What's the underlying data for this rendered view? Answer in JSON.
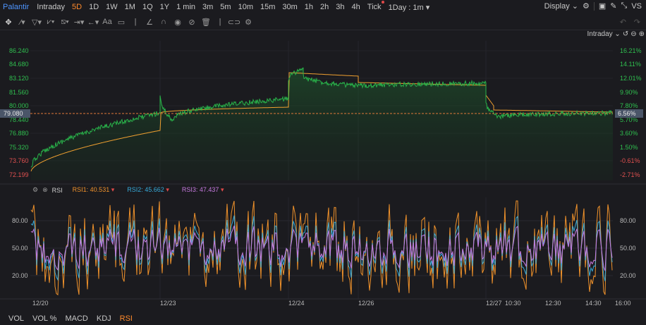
{
  "header": {
    "symbol": "Palantir",
    "timeframes": [
      "Intraday",
      "5D",
      "1D",
      "1W",
      "1M",
      "1Q",
      "1Y",
      "1 min",
      "3m",
      "5m",
      "10m",
      "15m",
      "30m",
      "1h",
      "2h",
      "3h",
      "4h",
      "Tick",
      "1Day : 1m"
    ],
    "active_timeframe": "5D",
    "display_label": "Display",
    "vs_label": "VS"
  },
  "session_label": "Intraday",
  "price_axis": [
    "86.240",
    "84.680",
    "83.120",
    "81.560",
    "80.000",
    "78.440",
    "76.880",
    "75.320",
    "73.760",
    "72.199"
  ],
  "current_price": "79.080",
  "pct_axis": [
    "16.21%",
    "14.11%",
    "12.01%",
    "9.90%",
    "7.80%",
    "5.70%",
    "3.60%",
    "1.50%",
    "-0.61%",
    "-2.71%"
  ],
  "current_pct": "6.56%",
  "x_axis": [
    "12/20",
    "12/23",
    "12/24",
    "12/26",
    "12/27",
    "10:30",
    "12:30",
    "14:30",
    "16:00"
  ],
  "rsi": {
    "title": "RSI",
    "rsi1_label": "RSI1:",
    "rsi1_value": "40.531",
    "rsi2_label": "RSI2:",
    "rsi2_value": "45.662",
    "rsi3_label": "RSI3:",
    "rsi3_value": "47.437",
    "levels": [
      "80.00",
      "50.00",
      "20.00"
    ]
  },
  "indicator_tabs": [
    "VOL",
    "VOL %",
    "MACD",
    "KDJ",
    "RSI"
  ],
  "active_indicator": "RSI",
  "colors": {
    "price_line": "#29b34a",
    "avg_line": "#f0a030",
    "rsi1": "#f0922b",
    "rsi2": "#36a9d8",
    "rsi3": "#c77ae0",
    "accent": "#ff8a2b",
    "current_price_bg": "#4a5568"
  }
}
